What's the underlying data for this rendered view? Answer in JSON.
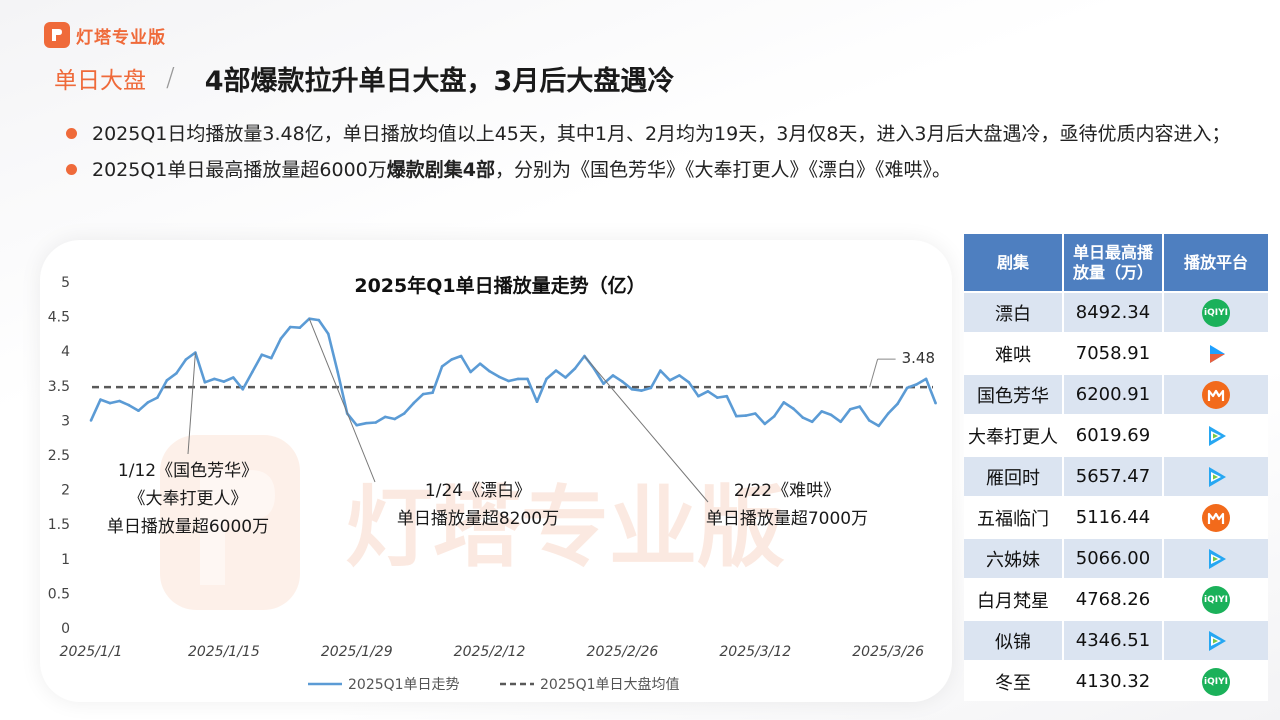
{
  "brand": {
    "name": "灯塔专业版"
  },
  "header": {
    "section": "单日大盘",
    "title": "4部爆款拉升单日大盘，3月后大盘遇冷"
  },
  "bullets": [
    {
      "text": "2025Q1日均播放量3.48亿，单日播放均值以上45天，其中1月、2月均为19天，3月仅8天，进入3月后大盘遇冷，亟待优质内容进入；"
    },
    {
      "pre": "2025Q1单日最高播放量超6000万",
      "bold": "爆款剧集4部",
      "post": "，分别为《国色芳华》《大奉打更人》《漂白》《难哄》。"
    }
  ],
  "watermark": "灯塔专业版",
  "colors": {
    "accent": "#ef6a3a",
    "line": "#5b9bd5",
    "avg": "#595959",
    "table_header": "#4e7fc0",
    "table_stripe": "#dbe4f1"
  },
  "chart_data": {
    "type": "line",
    "title": "2025年Q1单日播放量走势（亿）",
    "ylim": [
      0,
      5
    ],
    "yticks": [
      "0",
      "0.5",
      "1",
      "1.5",
      "2",
      "2.5",
      "3",
      "3.5",
      "4",
      "4.5",
      "5"
    ],
    "xticks": [
      "2025/1/1",
      "2025/1/15",
      "2025/1/29",
      "2025/2/12",
      "2025/2/26",
      "2025/3/12",
      "2025/3/26"
    ],
    "series": [
      {
        "name": "2025Q1单日走势",
        "values": [
          3.0,
          3.3,
          3.25,
          3.28,
          3.22,
          3.14,
          3.26,
          3.33,
          3.58,
          3.68,
          3.88,
          3.98,
          3.55,
          3.6,
          3.56,
          3.62,
          3.45,
          3.7,
          3.95,
          3.9,
          4.18,
          4.35,
          4.34,
          4.47,
          4.45,
          4.25,
          3.7,
          3.1,
          2.93,
          2.96,
          2.97,
          3.05,
          3.02,
          3.1,
          3.25,
          3.38,
          3.4,
          3.78,
          3.88,
          3.93,
          3.7,
          3.82,
          3.71,
          3.63,
          3.57,
          3.6,
          3.6,
          3.27,
          3.6,
          3.72,
          3.62,
          3.75,
          3.93,
          3.75,
          3.53,
          3.65,
          3.56,
          3.45,
          3.43,
          3.47,
          3.72,
          3.58,
          3.65,
          3.55,
          3.35,
          3.42,
          3.33,
          3.35,
          3.06,
          3.07,
          3.1,
          2.95,
          3.06,
          3.26,
          3.17,
          3.04,
          2.98,
          3.13,
          3.08,
          2.98,
          3.16,
          3.2,
          3.0,
          2.92,
          3.1,
          3.24,
          3.47,
          3.52,
          3.6,
          3.25
        ]
      },
      {
        "name": "2025Q1单日大盘均值",
        "constant": 3.48
      }
    ],
    "avg_label": "3.48",
    "annotations": [
      {
        "lines": [
          "1/12《国色芳华》",
          "《大奉打更人》",
          "单日播放量超6000万"
        ]
      },
      {
        "lines": [
          "1/24《漂白》",
          "单日播放量超8200万"
        ]
      },
      {
        "lines": [
          "2/22《难哄》",
          "单日播放量超7000万"
        ]
      }
    ],
    "legend_position": "bottom"
  },
  "table": {
    "headers": [
      "剧集",
      "单日最高播放量（万）",
      "播放平台"
    ],
    "header_line1": "单日最高播",
    "header_line2": "放量（万）",
    "rows": [
      {
        "name": "漂白",
        "value": "8492.34",
        "platform": "iqiyi-icon"
      },
      {
        "name": "难哄",
        "value": "7058.91",
        "platform": "youku-icon"
      },
      {
        "name": "国色芳华",
        "value": "6200.91",
        "platform": "mango-tv-icon"
      },
      {
        "name": "大奉打更人",
        "value": "6019.69",
        "platform": "tencent-video-icon"
      },
      {
        "name": "雁回时",
        "value": "5657.47",
        "platform": "tencent-video-icon"
      },
      {
        "name": "五福临门",
        "value": "5116.44",
        "platform": "mango-tv-icon"
      },
      {
        "name": "六姊妹",
        "value": "5066.00",
        "platform": "tencent-video-icon"
      },
      {
        "name": "白月梵星",
        "value": "4768.26",
        "platform": "iqiyi-icon"
      },
      {
        "name": "似锦",
        "value": "4346.51",
        "platform": "tencent-video-icon"
      },
      {
        "name": "冬至",
        "value": "4130.32",
        "platform": "iqiyi-icon"
      }
    ]
  }
}
